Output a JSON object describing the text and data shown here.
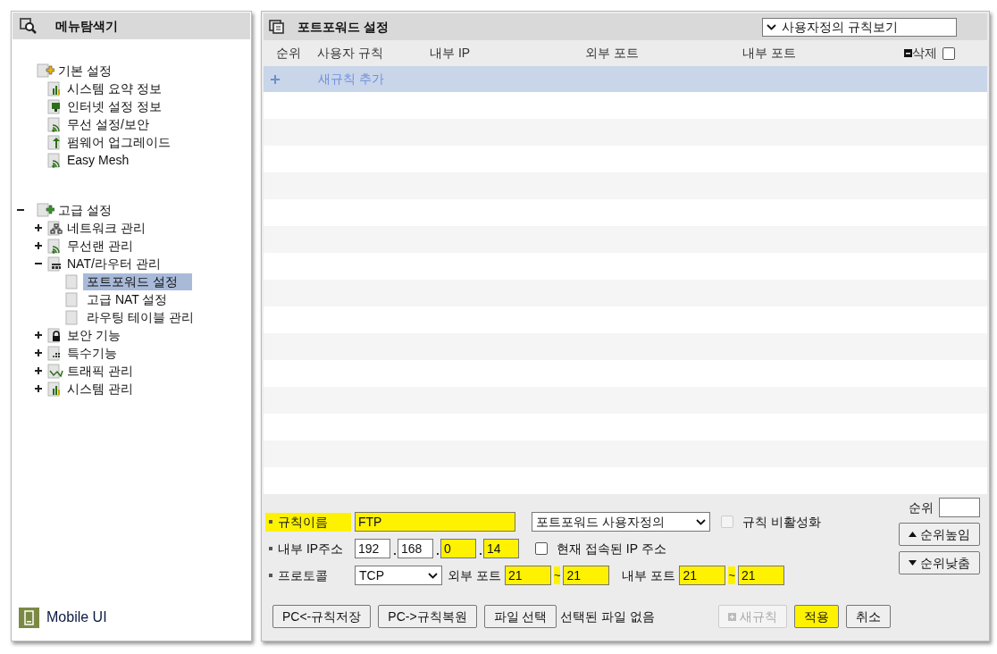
{
  "explorer": {
    "title": "메뉴탐색기",
    "groups": [
      {
        "label": "기본 설정",
        "selected": false,
        "children": [
          {
            "label": "시스템 요약 정보",
            "kind": "chart",
            "selected": false
          },
          {
            "label": "인터넷 설정 정보",
            "kind": "monitor",
            "selected": false
          },
          {
            "label": "무선 설정/보안",
            "kind": "wireless",
            "selected": false
          },
          {
            "label": "펌웨어 업그레이드",
            "kind": "upgrade",
            "selected": false
          },
          {
            "label": "Easy Mesh",
            "kind": "wireless",
            "selected": false
          }
        ]
      },
      {
        "label": "고급 설정",
        "selected": false,
        "expanded": true,
        "children": [
          {
            "label": "네트워크 관리",
            "kind": "network",
            "selected": false,
            "expanded": false
          },
          {
            "label": "무선랜 관리",
            "kind": "wireless",
            "selected": false,
            "expanded": false
          },
          {
            "label": "NAT/라우터 관리",
            "kind": "nat",
            "selected": false,
            "expanded": true,
            "children": [
              {
                "label": "포트포워드 설정",
                "kind": "page",
                "selected": true
              },
              {
                "label": "고급 NAT 설정",
                "kind": "page",
                "selected": false
              },
              {
                "label": "라우팅 테이블 관리",
                "kind": "page",
                "selected": false
              }
            ]
          },
          {
            "label": "보안 기능",
            "kind": "lock",
            "selected": false,
            "expanded": false
          },
          {
            "label": "특수기능",
            "kind": "grid",
            "selected": false,
            "expanded": false
          },
          {
            "label": "트래픽 관리",
            "kind": "traffic",
            "selected": false,
            "expanded": false
          },
          {
            "label": "시스템 관리",
            "kind": "chart",
            "selected": false,
            "expanded": false
          }
        ]
      }
    ],
    "mobile_link": "Mobile UI"
  },
  "panel": {
    "title": "포트포워드 설정",
    "view_select": "사용자정의 규칙보기",
    "columns": [
      "순위",
      "사용자 규칙",
      "내부 IP",
      "외부 포트",
      "내부 포트",
      "삭제"
    ],
    "select_all": {
      "checked": false
    },
    "new_rule_row": "새규칙 추가"
  },
  "form": {
    "rule_name": {
      "label": "규칙이름",
      "value": "FTP",
      "highlighted": true
    },
    "rule_type": "포트포워드 사용자정의",
    "disable_rule": {
      "label": "규칙 비활성화",
      "checked": false,
      "disabled": true
    },
    "internal_ip": {
      "label": "내부 IP주소",
      "octets": [
        {
          "value": "192",
          "highlighted": false
        },
        {
          "value": "168",
          "highlighted": false
        },
        {
          "value": "0",
          "highlighted": true
        },
        {
          "value": "14",
          "highlighted": true
        }
      ]
    },
    "current_ip": {
      "label": "현재 접속된 IP 주소",
      "checked": false
    },
    "protocol": {
      "label": "프로토콜",
      "value": "TCP"
    },
    "external_port": {
      "label": "외부 포트",
      "from": "21",
      "separator": "~",
      "to": "21",
      "highlighted": true
    },
    "internal_port": {
      "label": "내부 포트",
      "from": "21",
      "separator": "~",
      "to": "21",
      "highlighted": true
    },
    "order": {
      "label": "순위"
    },
    "order_buttons": [
      "순위높임",
      "순위낮춤"
    ]
  },
  "footer": {
    "save_button": "PC<-규칙저장",
    "restore_button": "PC->규칙복원",
    "file_button": "파일 선택",
    "file_status": "선택된 파일 없음",
    "actions": [
      {
        "label": "새규칙",
        "kind": "new",
        "disabled": true,
        "highlighted": false
      },
      {
        "label": "적용",
        "kind": "apply",
        "disabled": false,
        "highlighted": true
      },
      {
        "label": "취소",
        "kind": "cancel",
        "disabled": false,
        "highlighted": false
      }
    ]
  }
}
